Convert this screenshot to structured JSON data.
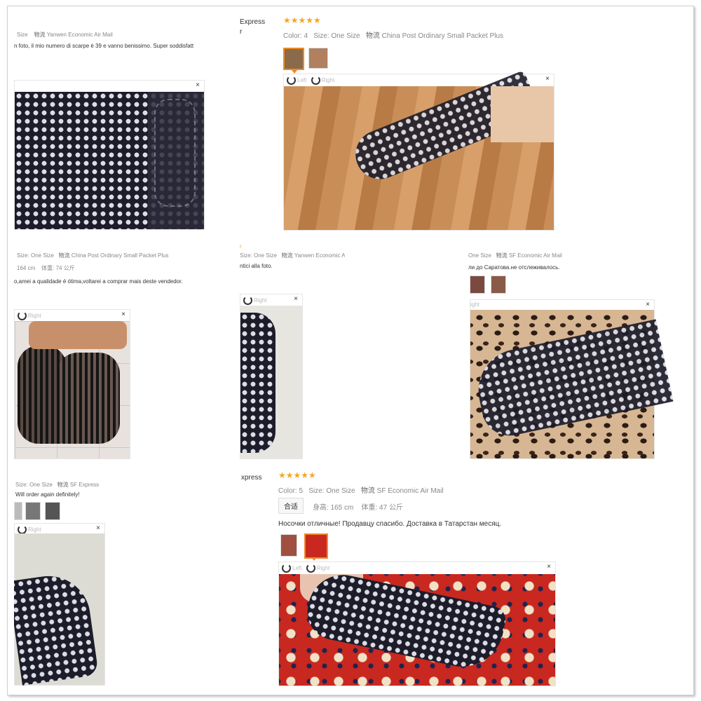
{
  "cards": {
    "topleft": {
      "meta_size": "Size",
      "meta_ship_label": "物流",
      "meta_ship": "Yanwen Economic Air Mail",
      "review": "n foto, il mio numero di scarpe è 39 e vanno benissimo. Super soddisfatt"
    },
    "topright": {
      "shipping_fragment_1": "Express",
      "shipping_fragment_2": "r",
      "stars": "★★★★★",
      "color_label": "Color:",
      "color_value": "4",
      "size_label": "Size:",
      "size_value": "One Size",
      "ship_label": "物流",
      "ship_value": "China Post Ordinary Small Packet Plus",
      "nav_left": "Left",
      "nav_right": "Right",
      "close": "×"
    },
    "midleft": {
      "meta_size": "Size: One Size",
      "meta_ship_label": "物流",
      "meta_ship": "China Post Ordinary Small Packet Plus",
      "height": "164 cm",
      "weight_label": "体重:",
      "weight": "74 公斤",
      "review": "o,amei a qualidade é ótima,voltarei a comprar mais deste vendedor.",
      "nav_right": "Right",
      "close": "×"
    },
    "midcenter": {
      "marker": "r",
      "meta_size": "Size: One Size",
      "meta_ship_label": "物流",
      "meta_ship": "Yanwen Economic Air Mail",
      "review": "ntici alla foto.",
      "nav_right": "Right",
      "close": "×"
    },
    "midright": {
      "meta_size": "One Size",
      "meta_ship_label": "物流",
      "meta_ship": "SF Economic Air Mail",
      "review": "ли до Саратова.не отслеживалось.",
      "nav_right": "ight",
      "close": "×"
    },
    "bottomleft": {
      "meta_size": "Size: One Size",
      "meta_ship_label": "物流",
      "meta_ship": "SF Express",
      "review": "Will order again definitely!",
      "nav_right": "Right",
      "close": "×"
    },
    "bottomright": {
      "shipping_fragment": "xpress",
      "stars": "★★★★★",
      "color_label": "Color:",
      "color_value": "5",
      "size_label": "Size:",
      "size_value": "One Size",
      "ship_label": "物流",
      "ship_value": "SF Economic Air Mail",
      "fit": "合适",
      "height_label": "身高:",
      "height": "165 cm",
      "weight_label": "体重:",
      "weight": "47 公斤",
      "review": "Носочки отличные! Продавцу спасибо. Доставка в Татарстан месяц.",
      "nav_left": "Left",
      "nav_right": "Right",
      "close": "×"
    }
  },
  "colors": {
    "star": "#f5a623",
    "selected_thumb": "#f08a24"
  }
}
